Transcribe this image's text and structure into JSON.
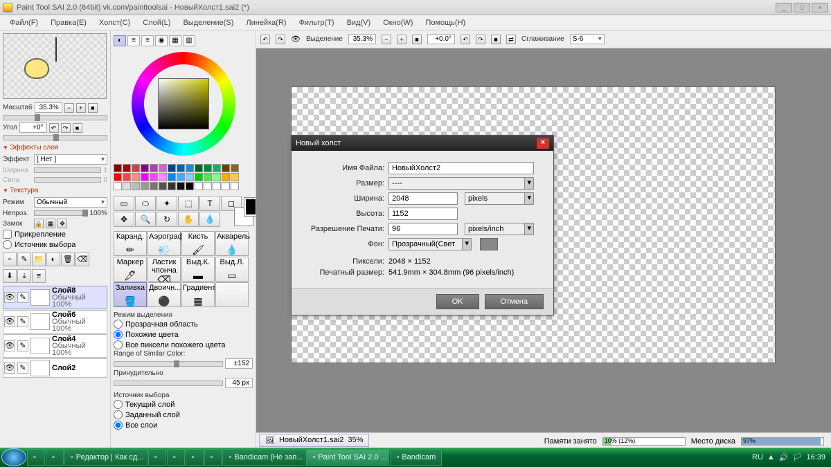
{
  "window": {
    "title": "Paint Tool SAI 2.0 (64bit) vk.com/painttoolsai - НовыйХолст1.sai2 (*)"
  },
  "menu": {
    "file": "Файл(F)",
    "edit": "Правка(E)",
    "canvas": "Холст(C)",
    "layer": "Слой(L)",
    "selection": "Выделение(S)",
    "ruler": "Линейка(R)",
    "filter": "Фильтр(T)",
    "view": "Вид(V)",
    "window": "Окно(W)",
    "help": "Помощь(H)"
  },
  "nav": {
    "scale_lbl": "Масштаб",
    "scale_val": "35.3%",
    "angle_lbl": "Угол",
    "angle_val": "+0°"
  },
  "layer_fx": {
    "header": "Эффекты слоя",
    "effect_lbl": "Эффект",
    "effect_val": "[ Нет ]",
    "width_lbl": "Ширина",
    "width_val": "1",
    "strength_lbl": "Сила",
    "strength_val": "0"
  },
  "texture": {
    "header": "Текстура",
    "mode_lbl": "Режим",
    "mode_val": "Обычный",
    "opacity_lbl": "Непроз.",
    "opacity_val": "100%",
    "lock_lbl": "Замок",
    "clip_lbl": "Прикрепление",
    "src_lbl": "Источник выбора"
  },
  "layers": [
    {
      "name": "Слой8",
      "mode": "Обычный",
      "opacity": "100%",
      "sel": true
    },
    {
      "name": "Слой6",
      "mode": "Обычный",
      "opacity": "100%"
    },
    {
      "name": "Слой4",
      "mode": "Обычный",
      "opacity": "100%"
    },
    {
      "name": "Слой2",
      "mode": "",
      "opacity": ""
    }
  ],
  "brushes": {
    "row1": [
      "Каранд.",
      "Аэрограф",
      "Кисть",
      "Акварель"
    ],
    "row2": [
      "Маркер",
      "Ластик чпонча",
      "Выд.К.",
      "Выд.Л."
    ],
    "row3": [
      "Заливка",
      "Двоичн...",
      "Градиент",
      ""
    ]
  },
  "sel_mode": {
    "header": "Режим выделения",
    "opt1": "Прозрачная область",
    "opt2": "Похожие цвета",
    "opt3": "Все пиксели похожего цвета",
    "range_lbl": "Range of Similar Color:",
    "range_val": "±152",
    "force_lbl": "Принудительно",
    "force_val": "45 px",
    "src_header": "Источник выбора",
    "src1": "Текущий слой",
    "src2": "Заданный слой",
    "src3": "Все слои"
  },
  "topbar": {
    "sel_lbl": "Выделение",
    "zoom": "35.3%",
    "angle": "+0.0°",
    "smooth_lbl": "Сглаживание",
    "smooth_val": "S-6"
  },
  "doc_tab": {
    "name": "НовыйХолст1.sai2",
    "zoom": "35%"
  },
  "dialog": {
    "title": "Новый холст",
    "fname_lbl": "Имя Файла:",
    "fname_val": "НовыйХолст2",
    "size_lbl": "Размер:",
    "size_val": "----",
    "width_lbl": "Ширина:",
    "width_val": "2048",
    "height_lbl": "Высота:",
    "height_val": "1152",
    "unit_val": "pixels",
    "res_lbl": "Разрешение Печати:",
    "res_val": "96",
    "res_unit": "pixels/inch",
    "bg_lbl": "Фон:",
    "bg_val": "Прозрачный(Свет",
    "px_lbl": "Пиксели:",
    "px_val": "2048 × 1152",
    "print_lbl": "Печатный размер:",
    "print_val": "541.9mm × 304.8mm (96 pixels/inch)",
    "ok": "OK",
    "cancel": "Отмена"
  },
  "status": {
    "mem_lbl": "Памяти занято",
    "mem_txt": "10% (12%)",
    "mem_pct": 10,
    "disk_lbl": "Место диска",
    "disk_txt": "97%",
    "disk_pct": 97
  },
  "taskbar": {
    "items": [
      "",
      "",
      "Редактор | Как сд...",
      "",
      "",
      "",
      "",
      "Bandicam (Не зап...",
      "Paint Tool SAI 2.0 ...",
      "Bandicam"
    ],
    "lang": "RU",
    "time": "16:39"
  },
  "swatch_colors": [
    "#800",
    "#a00",
    "#c44",
    "#808",
    "#a4a",
    "#c6c",
    "#048",
    "#06a",
    "#28c",
    "#062",
    "#084",
    "#2a6",
    "#640",
    "#862",
    "#f00",
    "#f44",
    "#f88",
    "#f0f",
    "#f4f",
    "#f8f",
    "#08f",
    "#4af",
    "#8cf",
    "#0c0",
    "#4e4",
    "#8f8",
    "#fa0",
    "#fc4",
    "#fff",
    "#ddd",
    "#bbb",
    "#999",
    "#777",
    "#555",
    "#333",
    "#111",
    "#000",
    "#fff",
    "#fff",
    "#fff",
    "#fff",
    "#fff"
  ]
}
